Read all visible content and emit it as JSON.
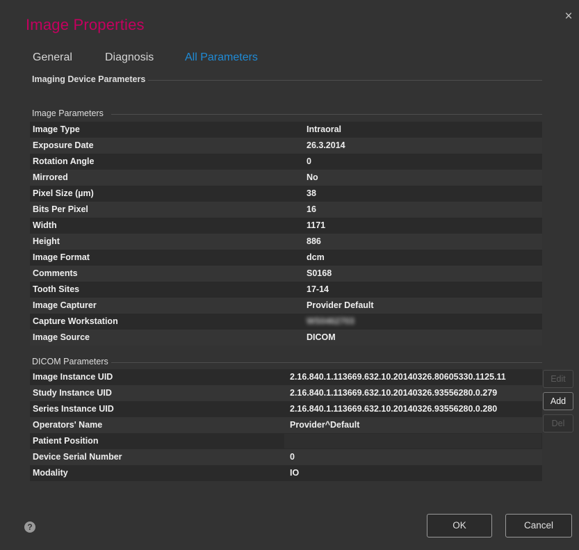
{
  "dialog": {
    "title": "Image Properties",
    "close_glyph": "×"
  },
  "tabs": [
    {
      "label": "General",
      "active": false
    },
    {
      "label": "Diagnosis",
      "active": false
    },
    {
      "label": "All Parameters",
      "active": true
    }
  ],
  "sections": {
    "imaging_device": "Imaging Device Parameters",
    "image_params": "Image Parameters",
    "dicom_params": "DICOM Parameters"
  },
  "image_parameters": [
    {
      "key": "Image Type",
      "value": "Intraoral"
    },
    {
      "key": "Exposure Date",
      "value": "26.3.2014"
    },
    {
      "key": "Rotation Angle",
      "value": "0"
    },
    {
      "key": "Mirrored",
      "value": "No"
    },
    {
      "key": "Pixel Size (µm)",
      "value": "38"
    },
    {
      "key": "Bits Per Pixel",
      "value": "16"
    },
    {
      "key": "Width",
      "value": "1171"
    },
    {
      "key": "Height",
      "value": "886"
    },
    {
      "key": "Image Format",
      "value": "dcm"
    },
    {
      "key": "Comments",
      "value": "S0168"
    },
    {
      "key": "Tooth Sites",
      "value": "17-14"
    },
    {
      "key": "Image Capturer",
      "value": "Provider Default"
    },
    {
      "key": "Capture Workstation",
      "value": "WS0462703"
    },
    {
      "key": "Image Source",
      "value": "DICOM"
    }
  ],
  "dicom_parameters": [
    {
      "key": "Image Instance UID",
      "value": "2.16.840.1.113669.632.10.20140326.80605330.1125.11"
    },
    {
      "key": "Study Instance UID",
      "value": "2.16.840.1.113669.632.10.20140326.93556280.0.279"
    },
    {
      "key": "Series Instance UID",
      "value": "2.16.840.1.113669.632.10.20140326.93556280.0.280"
    },
    {
      "key": "Operators' Name",
      "value": "Provider^Default"
    },
    {
      "key": "Patient Position",
      "value": ""
    },
    {
      "key": "Device Serial Number",
      "value": "0"
    },
    {
      "key": "Modality",
      "value": "IO"
    }
  ],
  "side_buttons": {
    "edit": "Edit",
    "add": "Add",
    "del": "Del"
  },
  "footer": {
    "help_glyph": "?",
    "ok": "OK",
    "cancel": "Cancel"
  },
  "colors": {
    "title": "#c4005f",
    "active_tab": "#1f8bd6",
    "background": "#333333"
  }
}
